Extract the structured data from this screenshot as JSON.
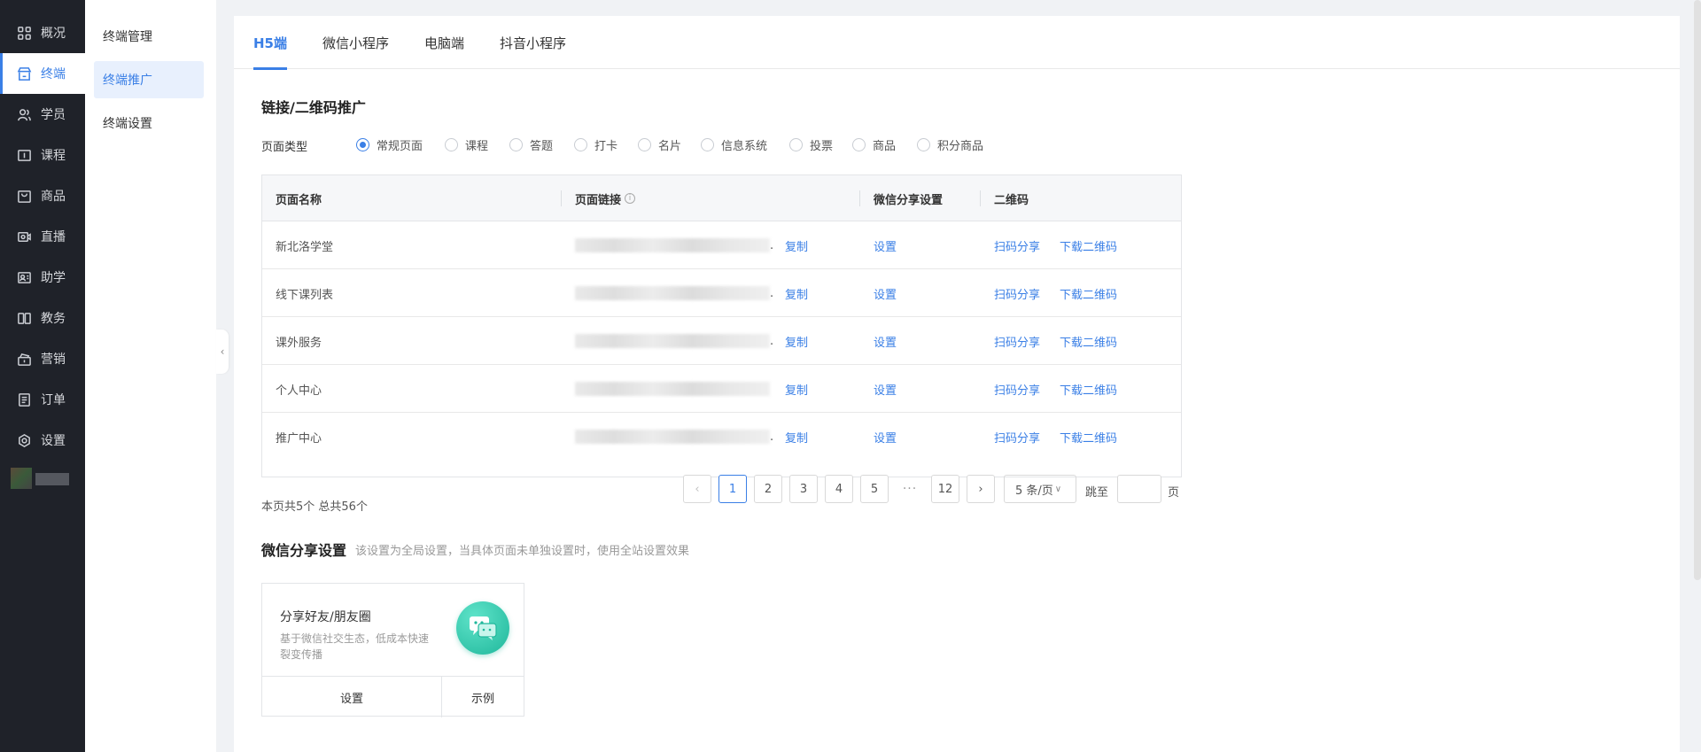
{
  "nav": {
    "items": [
      {
        "label": "概况",
        "icon": "dashboard-icon"
      },
      {
        "label": "终端",
        "icon": "store-icon"
      },
      {
        "label": "学员",
        "icon": "users-icon"
      },
      {
        "label": "课程",
        "icon": "course-icon"
      },
      {
        "label": "商品",
        "icon": "goods-icon"
      },
      {
        "label": "直播",
        "icon": "live-icon"
      },
      {
        "label": "助学",
        "icon": "study-icon"
      },
      {
        "label": "教务",
        "icon": "book-icon"
      },
      {
        "label": "营销",
        "icon": "marketing-icon"
      },
      {
        "label": "订单",
        "icon": "order-icon"
      },
      {
        "label": "设置",
        "icon": "settings-icon"
      }
    ],
    "active_index": 1
  },
  "subnav": {
    "items": [
      {
        "label": "终端管理"
      },
      {
        "label": "终端推广"
      },
      {
        "label": "终端设置"
      }
    ]
  },
  "tabs": [
    {
      "label": "H5端"
    },
    {
      "label": "微信小程序"
    },
    {
      "label": "电脑端"
    },
    {
      "label": "抖音小程序"
    }
  ],
  "promo": {
    "title": "链接/二维码推广",
    "page_type_label": "页面类型",
    "page_types": [
      "常规页面",
      "课程",
      "答题",
      "打卡",
      "名片",
      "信息系统",
      "投票",
      "商品",
      "积分商品"
    ]
  },
  "table": {
    "headers": {
      "name": "页面名称",
      "link": "页面链接",
      "wechat": "微信分享设置",
      "qrcode": "二维码"
    },
    "rows": [
      {
        "name": "新北洛学堂",
        "link_suffix": ".",
        "copy": "复制",
        "setting": "设置",
        "scan": "扫码分享",
        "download": "下载二维码"
      },
      {
        "name": "线下课列表",
        "link_suffix": ".",
        "copy": "复制",
        "setting": "设置",
        "scan": "扫码分享",
        "download": "下载二维码"
      },
      {
        "name": "课外服务",
        "link_suffix": ".",
        "copy": "复制",
        "setting": "设置",
        "scan": "扫码分享",
        "download": "下载二维码"
      },
      {
        "name": "个人中心",
        "link_suffix": "",
        "copy": "复制",
        "setting": "设置",
        "scan": "扫码分享",
        "download": "下载二维码"
      },
      {
        "name": "推广中心",
        "link_suffix": ".",
        "copy": "复制",
        "setting": "设置",
        "scan": "扫码分享",
        "download": "下载二维码"
      }
    ]
  },
  "pagination": {
    "summary": "本页共5个 总共56个",
    "pages": [
      "1",
      "2",
      "3",
      "4",
      "5"
    ],
    "ellipsis": "···",
    "last_page": "12",
    "current": "1",
    "page_size": "5 条/页",
    "jump_label": "跳至",
    "jump_unit": "页",
    "jump_value": ""
  },
  "wechat_share": {
    "title": "微信分享设置",
    "description": "该设置为全局设置，当具体页面未单独设置时，使用全站设置效果",
    "card": {
      "title": "分享好友/朋友圈",
      "description": "基于微信社交生态，低成本快速裂变传播",
      "setting_label": "设置",
      "example_label": "示例",
      "icon": "wechat-icon"
    }
  },
  "colors": {
    "primary": "#3a7fe6",
    "nav_bg": "#1f2229",
    "wechat_green": "#1fb79b"
  }
}
